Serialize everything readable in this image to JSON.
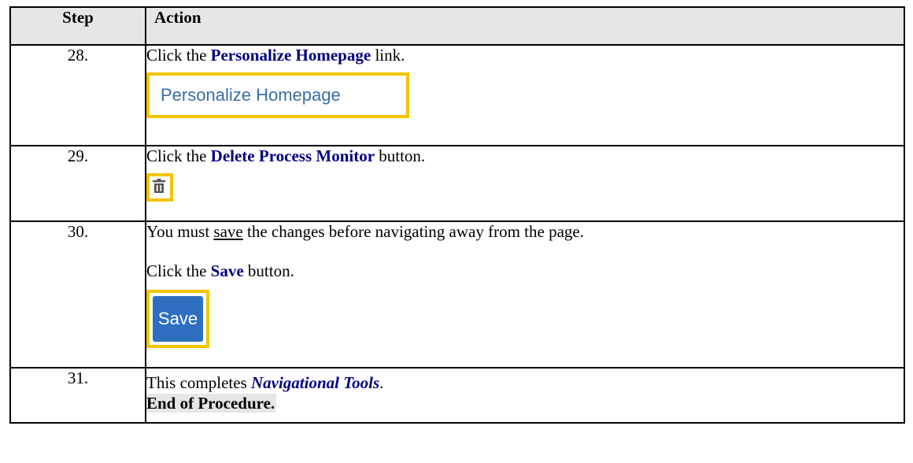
{
  "headers": {
    "step": "Step",
    "action": "Action"
  },
  "rows": [
    {
      "num": "28.",
      "pre": "Click the ",
      "kw": "Personalize Homepage",
      "post": " link.",
      "shot": "Personalize Homepage"
    },
    {
      "num": "29.",
      "pre": "Click the ",
      "kw": "Delete Process Monitor",
      "post": " button.",
      "icon": "trash-icon"
    },
    {
      "num": "30.",
      "line1_pre": "You must ",
      "line1_u": "save",
      "line1_post": " the changes before navigating away from the page.",
      "pre": "Click the ",
      "kw": "Save",
      "post": " button.",
      "shot": "Save"
    },
    {
      "num": "31.",
      "pre": "This completes ",
      "title": "Navigational Tools",
      "post": ".",
      "end": "End of Procedure."
    }
  ],
  "colors": {
    "highlight": "#f5c400",
    "keyword": "#000080",
    "save_button": "#2f6fbf",
    "header_bg": "#e6e6e6"
  }
}
